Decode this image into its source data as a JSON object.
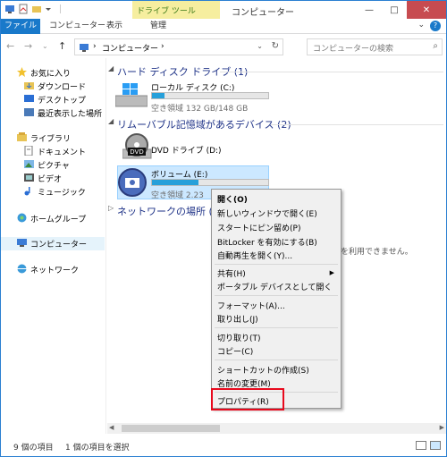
{
  "window": {
    "context_tab_label": "ドライブ ツール",
    "title": "コンピューター",
    "buttons": {
      "minimize": "—",
      "maximize": "□",
      "close": "✕"
    }
  },
  "ribbon": {
    "tabs": [
      "ファイル",
      "コンピューター",
      "表示",
      "管理"
    ],
    "help_label": "?"
  },
  "address": {
    "back": "←",
    "forward": "→",
    "up": "↑",
    "path": "コンピューター",
    "sep": "›",
    "search_placeholder": "コンピューターの検索"
  },
  "nav": {
    "items": [
      {
        "label": "お気に入り",
        "icon": "star-icon"
      },
      {
        "label": "ダウンロード",
        "icon": "download-folder-icon"
      },
      {
        "label": "デスクトップ",
        "icon": "desktop-icon"
      },
      {
        "label": "最近表示した場所",
        "icon": "recent-places-icon"
      },
      {
        "label": "ライブラリ",
        "icon": "library-icon"
      },
      {
        "label": "ドキュメント",
        "icon": "documents-icon"
      },
      {
        "label": "ピクチャ",
        "icon": "pictures-icon"
      },
      {
        "label": "ビデオ",
        "icon": "video-icon"
      },
      {
        "label": "ミュージック",
        "icon": "music-icon"
      },
      {
        "label": "ホームグループ",
        "icon": "homegroup-icon"
      },
      {
        "label": "コンピューター",
        "icon": "computer-icon"
      },
      {
        "label": "ネットワーク",
        "icon": "network-icon"
      }
    ]
  },
  "content": {
    "groups": [
      {
        "title": "ハード ディスク ドライブ (1)"
      },
      {
        "title": "リムーバブル記憶域があるデバイス (2)"
      },
      {
        "title": "ネットワークの場所 (6"
      }
    ],
    "drives": [
      {
        "name": "ローカル ディスク (C:)",
        "free": "空き領域 132 GB/148 GB",
        "used_fraction": 0.11
      },
      {
        "name": "DVD ドライブ (D:)",
        "icon_label": "DVD"
      },
      {
        "name": "ボリューム (E:)",
        "free": "空き領域 2.23",
        "used_fraction": 0.4
      }
    ],
    "partial_text": "を利用できません。"
  },
  "context_menu": {
    "items": [
      {
        "label": "開く(O)",
        "bold": true
      },
      {
        "label": "新しいウィンドウで開く(E)"
      },
      {
        "label": "スタートにピン留め(P)"
      },
      {
        "label": "BitLocker を有効にする(B)"
      },
      {
        "label": "自動再生を開く(Y)..."
      },
      {
        "label": "共有(H)",
        "submenu": true
      },
      {
        "label": "ポータブル デバイスとして開く"
      },
      {
        "label": "フォーマット(A)..."
      },
      {
        "label": "取り出し(J)"
      },
      {
        "label": "切り取り(T)"
      },
      {
        "label": "コピー(C)"
      },
      {
        "label": "ショートカットの作成(S)"
      },
      {
        "label": "名前の変更(M)"
      },
      {
        "label": "プロパティ(R)"
      }
    ],
    "submenu_glyph": "▶"
  },
  "status": {
    "items_count": "9 個の項目",
    "selected": "1 個の項目を選択"
  },
  "colors": {
    "accent": "#1979ca",
    "highlight_border": "#e8091d",
    "context_tab_bg": "#f6ee9f"
  }
}
